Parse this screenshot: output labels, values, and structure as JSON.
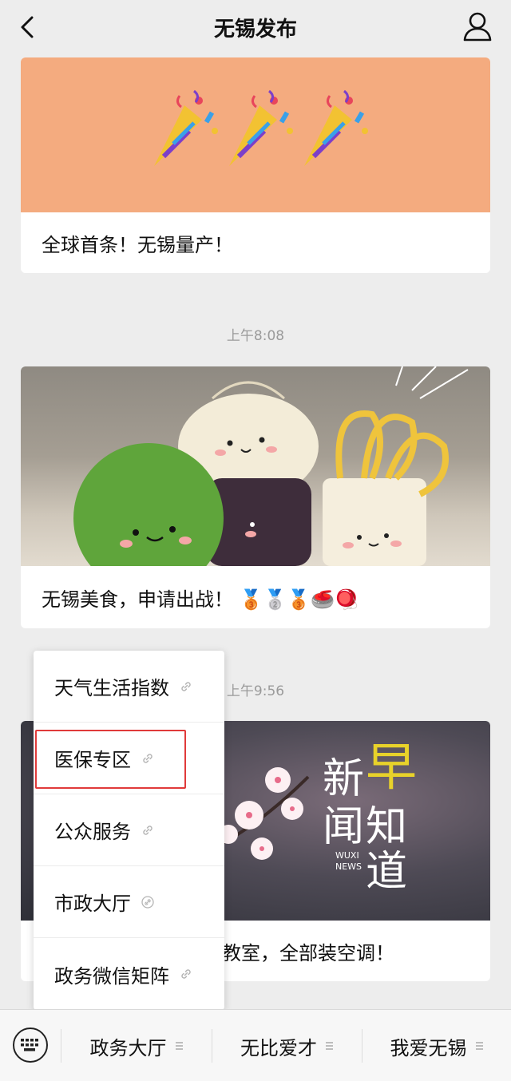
{
  "header": {
    "title": "无锡发布",
    "back_icon": "chevron-left-icon",
    "profile_icon": "person-icon"
  },
  "messages": [
    {
      "caption": "全球首条！无锡量产！",
      "image": "party-popper-banner"
    },
    {
      "time": "上午8:08",
      "caption": "无锡美食，申请出战！ 🥉🥈🥉🥌🪀",
      "image": "cute-food-characters"
    },
    {
      "time": "上午9:56",
      "caption": "教室，全部装空调！",
      "image": "plum-blossom-news",
      "image_text": [
        "新",
        "早",
        "闻",
        "知",
        "道"
      ],
      "image_small": [
        "WUXI",
        "NEWS"
      ]
    }
  ],
  "popup_menu": {
    "items": [
      {
        "label": "天气生活指数",
        "icon": "link-icon"
      },
      {
        "label": "医保专区",
        "icon": "link-icon"
      },
      {
        "label": "公众服务",
        "icon": "link-icon"
      },
      {
        "label": "市政大厅",
        "icon": "link-icon"
      },
      {
        "label": "政务微信矩阵",
        "icon": "link-icon"
      }
    ]
  },
  "bottom_menu": {
    "keyboard_icon": "keyboard-icon",
    "tabs": [
      {
        "label": "政务大厅"
      },
      {
        "label": "无比爱才"
      },
      {
        "label": "我爱无锡"
      }
    ]
  },
  "colors": {
    "highlight": "#e03a3a",
    "banner": "#f4ab7f"
  }
}
